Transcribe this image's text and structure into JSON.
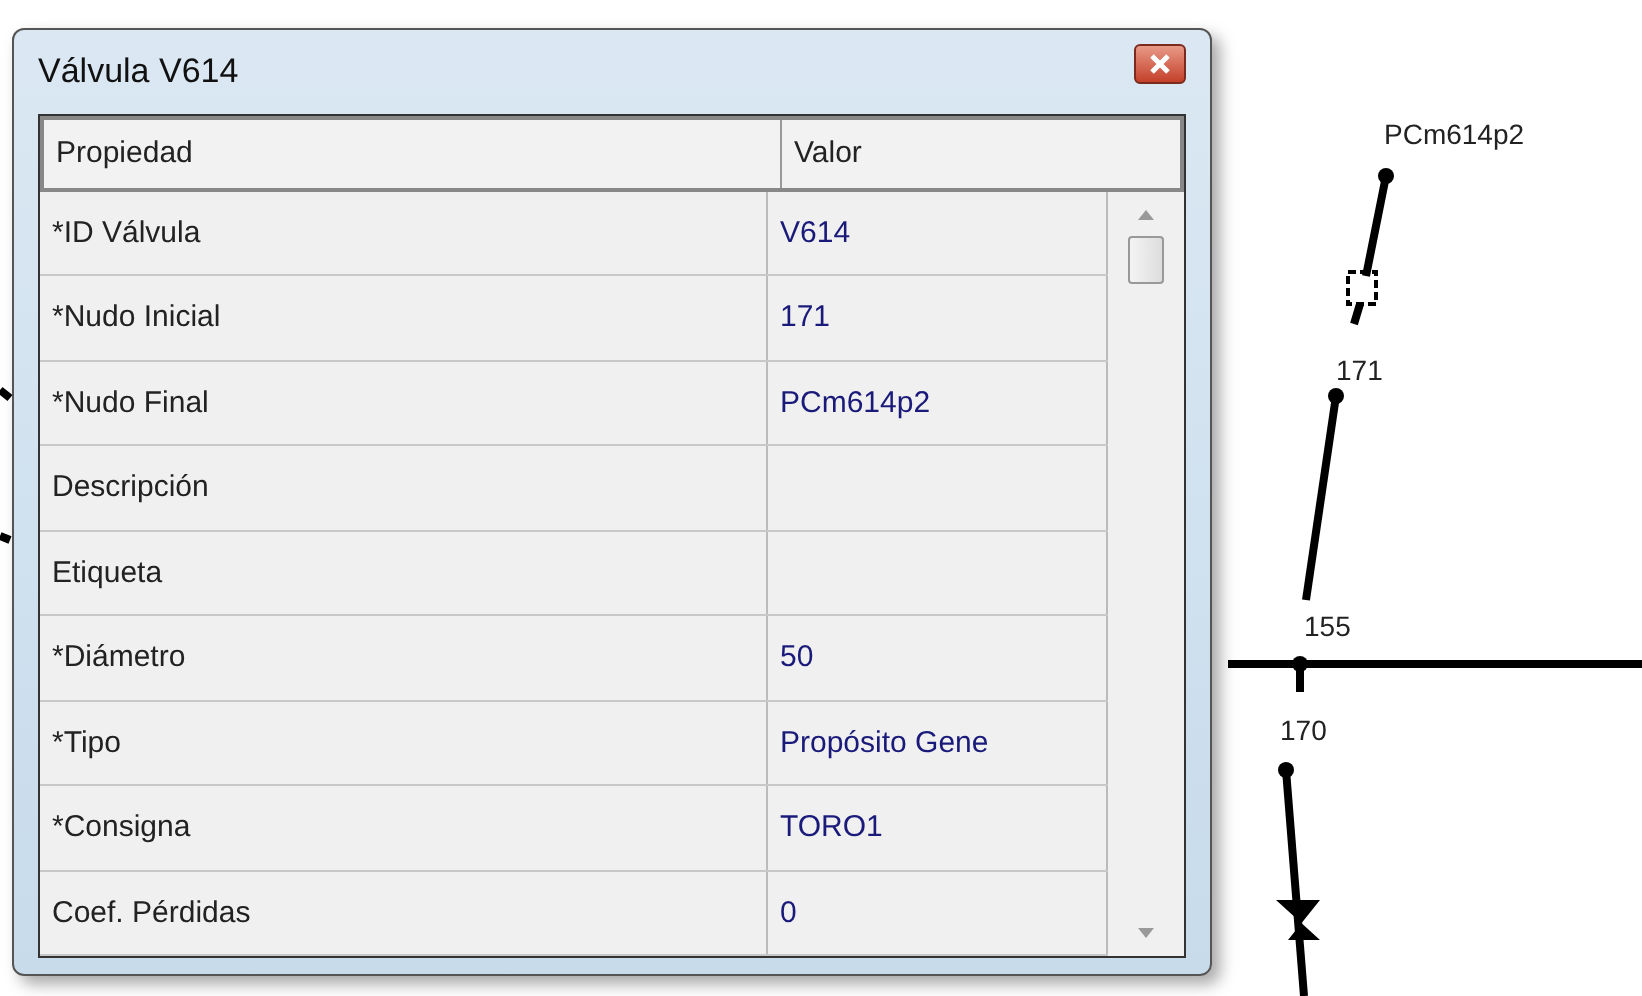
{
  "window": {
    "title": "Válvula V614"
  },
  "table": {
    "columns": [
      "Propiedad",
      "Valor"
    ],
    "rows": [
      {
        "property": "*ID Válvula",
        "value": "V614"
      },
      {
        "property": "*Nudo Inicial",
        "value": "171"
      },
      {
        "property": "*Nudo Final",
        "value": "PCm614p2"
      },
      {
        "property": "Descripción",
        "value": ""
      },
      {
        "property": "Etiqueta",
        "value": ""
      },
      {
        "property": "*Diámetro",
        "value": "50"
      },
      {
        "property": "*Tipo",
        "value": "Propósito Gene"
      },
      {
        "property": "*Consigna",
        "value": "TORO1"
      },
      {
        "property": "Coef. Pérdidas",
        "value": "0"
      }
    ]
  },
  "map": {
    "node_labels": [
      "PCm614p2",
      "171",
      "155",
      "170"
    ]
  }
}
